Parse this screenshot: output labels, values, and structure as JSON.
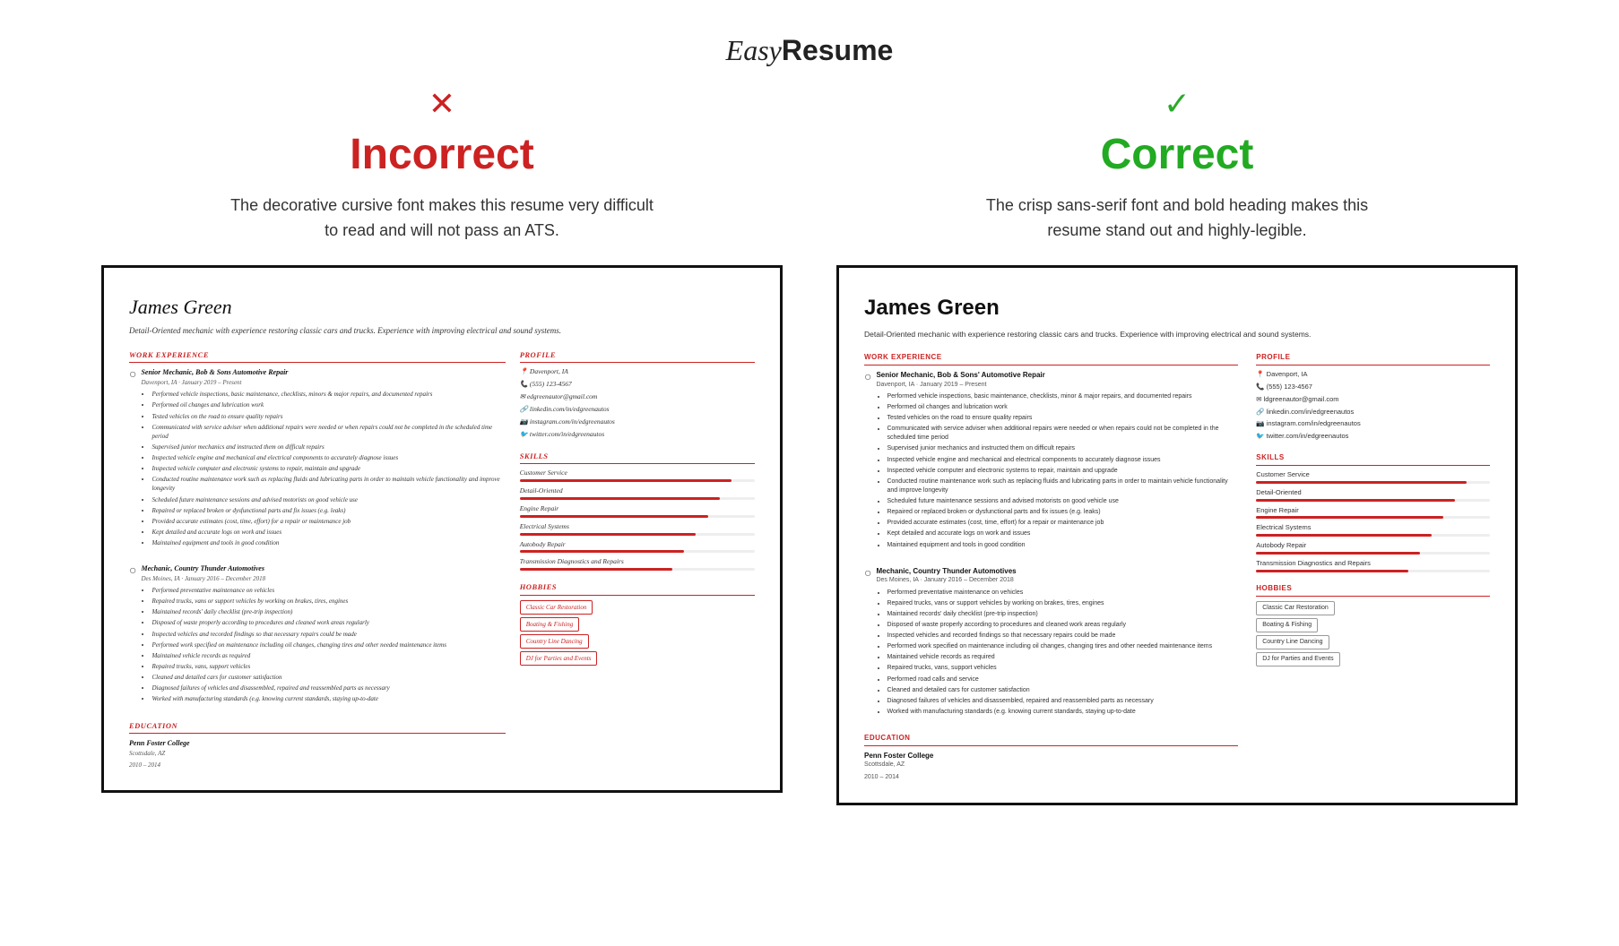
{
  "header": {
    "logo_easy": "Easy",
    "logo_resume": "Resume"
  },
  "incorrect": {
    "icon": "✕",
    "label": "Incorrect",
    "description": "The decorative cursive font makes this resume very difficult to read and will not pass an ATS.",
    "resume": {
      "name": "James Green",
      "tagline": "Detail-Oriented mechanic with experience restoring classic cars and trucks. Experience\nwith improving electrical and sound systems.",
      "work_experience_title": "WORK EXPERIENCE",
      "jobs": [
        {
          "title": "Senior Mechanic, Bob & Sons Automotive Repair",
          "meta": "Davenport, IA · January 2019 – Present",
          "bullets": [
            "Performed vehicle inspections, basic maintenance, checklists, minors & major repairs, and documented repairs",
            "Performed oil changes and lubrication work",
            "Tested vehicles on the road to ensure quality repairs",
            "Communicated with service adviser when additional repairs were needed or when repairs could not be completed in the scheduled time period",
            "Supervised junior mechanics and instructed them on difficult repairs",
            "Inspected vehicle engine and mechanical and electrical components to accurately diagnose issues",
            "Inspected vehicle computer and electronic systems to repair, maintain and upgrade",
            "Conducted routine maintenance work such as replacing fluids and lubricating parts in order to maintain vehicle functionality and improve longevity",
            "Scheduled future maintenance sessions and advised motorists on good vehicle use",
            "Repaired or replaced broken or dysfunctional parts and fix issues (e.g. leaks)",
            "Provided accurate estimates (cost, time, effort) for a repair or maintenance job",
            "Kept detailed and accurate logs on work and issues",
            "Maintained equipment and tools in good condition"
          ]
        },
        {
          "title": "Mechanic, Country Thunder Automotives",
          "meta": "Des Moines, IA · January 2016 – December 2018",
          "bullets": [
            "Performed preventative maintenance on vehicles",
            "Repaired trucks, vans or support vehicles by working on brakes, tires, engines",
            "Maintained records' daily checklist (pre-trip inspection)",
            "Disposed of waste properly according to procedures and cleaned work areas regularly",
            "Inspected vehicles and recorded findings so that necessary repairs could be made",
            "Performed work specified on maintenance including oil changes, changing tires and other needed maintenance items",
            "Maintained vehicle records as required",
            "Repaired trucks, vans, support vehicles",
            "Cleaned and detailed cars for customer satisfaction",
            "Diagnosed failures of vehicles and disassembled, repaired and reassembled parts as necessary",
            "Worked with manufacturing standards (e.g. knowing current standards, staying up-to-date"
          ]
        }
      ],
      "education_title": "EDUCATION",
      "education": {
        "school": "Penn Foster College",
        "degree": "Scottsdale, AZ",
        "years": "2010 – 2014"
      },
      "profile_title": "PROFILE",
      "profile_items": [
        "Davenport, IA",
        "(555) 123-4567",
        "edgreenautor@gmail.com",
        "linkedin.com/in/edgreenautos",
        "instagram.com/in/edgreenautos",
        "twitter.com/in/edgreenautos"
      ],
      "skills_title": "SKILLS",
      "skills": [
        {
          "label": "Customer Service",
          "pct": 90
        },
        {
          "label": "Detail-Oriented",
          "pct": 85
        },
        {
          "label": "Engine Repair",
          "pct": 80
        },
        {
          "label": "Electrical Systems",
          "pct": 75
        },
        {
          "label": "Autobody Repair",
          "pct": 70
        },
        {
          "label": "Transmission Diagnostics and Repairs",
          "pct": 65
        }
      ],
      "hobbies_title": "HOBBIES",
      "hobbies": [
        "Classic Car Restoration",
        "Boating & Fishing",
        "Country Line Dancing",
        "DJ for Parties and Events"
      ]
    }
  },
  "correct": {
    "icon": "✓",
    "label": "Correct",
    "description": "The crisp sans-serif font and bold heading makes this resume stand out and highly-legible.",
    "resume": {
      "name": "James Green",
      "tagline": "Detail-Oriented mechanic with experience restoring classic cars and\ntrucks. Experience with improving electrical and sound systems.",
      "work_experience_title": "WORK EXPERIENCE",
      "jobs": [
        {
          "title": "Senior Mechanic, Bob & Sons' Automotive Repair",
          "meta": "Davenport, IA · January 2019 – Present",
          "bullets": [
            "Performed vehicle inspections, basic maintenance, checklists, minor & major repairs, and documented repairs",
            "Performed oil changes and lubrication work",
            "Tested vehicles on the road to ensure quality repairs",
            "Communicated with service adviser when additional repairs were needed or when repairs could not be completed in the scheduled time period",
            "Supervised junior mechanics and instructed them on difficult repairs",
            "Inspected vehicle engine and mechanical and electrical components to accurately diagnose issues",
            "Inspected vehicle computer and electronic systems to repair, maintain and upgrade",
            "Conducted routine maintenance work such as replacing fluids and lubricating parts in order to maintain vehicle functionality and improve longevity",
            "Scheduled future maintenance sessions and advised motorists on good vehicle use",
            "Repaired or replaced broken or dysfunctional parts and fix issues (e.g. leaks)",
            "Provided accurate estimates (cost, time, effort) for a repair or maintenance job",
            "Kept detailed and accurate logs on work and issues",
            "Maintained equipment and tools in good condition"
          ]
        },
        {
          "title": "Mechanic, Country Thunder Automotives",
          "meta": "Des Moines, IA · January 2016 – December 2018",
          "bullets": [
            "Performed preventative maintenance on vehicles",
            "Repaired trucks, vans or support vehicles by working on brakes, tires, engines",
            "Maintained records' daily checklist (pre-trip inspection)",
            "Disposed of waste properly according to procedures and cleaned work areas regularly",
            "Inspected vehicles and recorded findings so that necessary repairs could be made",
            "Performed work specified on maintenance including oil changes, changing tires and other needed maintenance items",
            "Maintained vehicle records as required",
            "Repaired trucks, vans, support vehicles",
            "Cleaned and detailed cars for customer satisfaction",
            "Diagnosed failures of vehicles and disassembled, repaired and reassembled parts as necessary",
            "Worked with manufacturing standards (e.g. knowing current standards, staying up-to-date"
          ]
        }
      ],
      "education_title": "EDUCATION",
      "education": {
        "school": "Penn Foster College",
        "degree": "Scottsdale, AZ",
        "years": "2010 – 2014"
      },
      "profile_title": "PROFILE",
      "profile_items": [
        "Davenport, IA",
        "(555) 123-4567",
        "ldgreenautor@gmail.com",
        "linkedin.com/in/edgreenautos",
        "instagram.com/in/edgreenautos",
        "twitter.com/in/edgreenautos"
      ],
      "skills_title": "SKILLS",
      "skills": [
        {
          "label": "Customer Service",
          "pct": 90
        },
        {
          "label": "Detail-Oriented",
          "pct": 85
        },
        {
          "label": "Engine Repair",
          "pct": 80
        },
        {
          "label": "Electrical Systems",
          "pct": 75
        },
        {
          "label": "Autobody Repair",
          "pct": 70
        },
        {
          "label": "Transmission Diagnostics and Repairs",
          "pct": 65
        }
      ],
      "hobbies_title": "HOBBIES",
      "hobbies": [
        "Classic Car Restoration",
        "Boating & Fishing",
        "Country Line Dancing",
        "DJ for Parties and Events"
      ]
    }
  }
}
